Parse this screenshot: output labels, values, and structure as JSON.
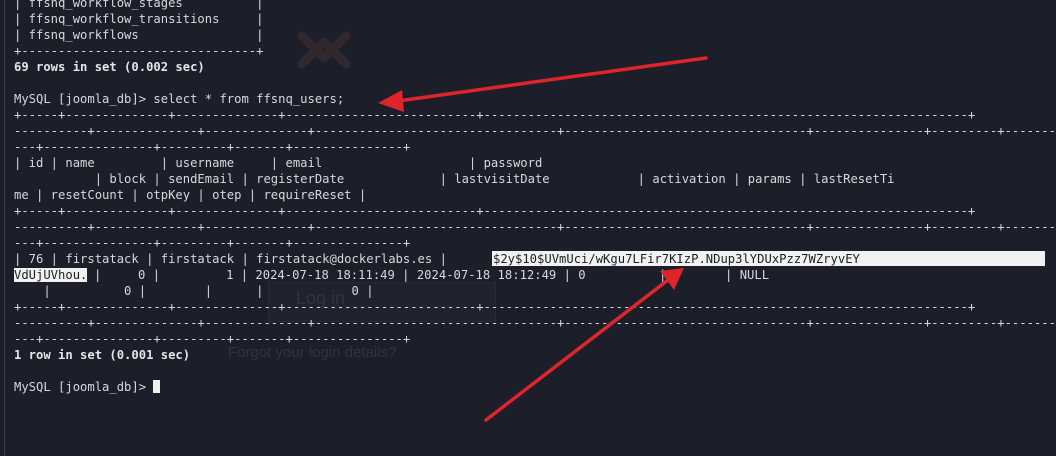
{
  "terminal": {
    "lines": [
      "| ffsnq_workflow_stages          |",
      "| ffsnq_workflow_transitions     |",
      "| ffsnq_workflows                |",
      "+--------------------------------+",
      "69 rows in set (0.002 sec)",
      "",
      "MySQL [joomla_db]> select * from ffsnq_users;",
      "+-----+--------------+--------------+--------------------------+------------------------------------------------------------------+",
      "----------+--------------+--------------+---------------------------------+---------------------------------+---------------+---------+-----------------------------------------------+",
      "---+---------------+---------+-------+---------------+",
      "| id | name         | username     | email                    | password",
      "           | block | sendEmail | registerDate             | lastvisitDate            | activation | params | lastResetTi",
      "me | resetCount | otpKey | otep | requireReset |",
      "+-----+--------------+--------------+--------------------------+------------------------------------------------------------------+",
      "----------+--------------+--------------+---------------------------------+---------------------------------+---------------+---------+-----------------------------------------------+",
      "---+---------------+---------+-------+---------------+",
      "| 76 | firstatack | firstatack | firstatack@dockerlabs.es | ",
      "VdUjUVhou.",
      "|     0 |         1 | 2024-07-18 18:11:49 | 2024-07-18 18:12:49 | 0          |        | NULL",
      "    |          0 |        |      |            0 |",
      "+-----+--------------+--------------+--------------------------+------------------------------------------------------------------+",
      "----------+--------------+--------------+---------------------------------+---------------------------------+---------------+---------+-----------------------------------------------+",
      "---+---------------+---------+-------+---------------+",
      "1 row in set (0.001 sec)",
      "",
      "MySQL [joomla_db]> "
    ],
    "password_hash_part1": "$2y$10$UVmUci/wKgu7LFir7KIzP.NDup3lYDUxPzz7WZryvEY",
    "password_hash_part2": "VdUjUVhou.",
    "background_ghost": {
      "login_label": "Log in",
      "forgot_label": "Forgot your login details?"
    }
  },
  "colors": {
    "background": "#1c1f29",
    "text": "#d7d8dc",
    "highlight": "#f1f1f1",
    "arrow": "#e0242b"
  }
}
